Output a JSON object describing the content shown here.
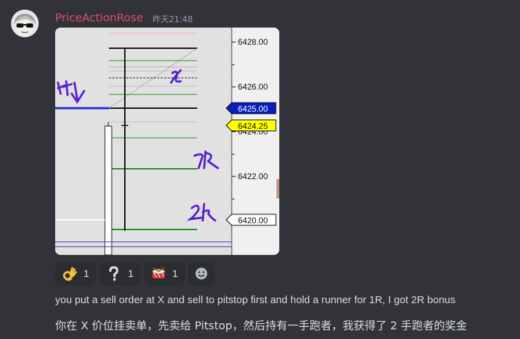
{
  "message": {
    "username": "PriceActionRose",
    "timestamp": "昨天21:48",
    "text_en": "you put a sell order at X and sell to pitstop first and hold a runner for 1R, I got 2R bonus",
    "text_zh": "你在 X 价位挂卖单，先卖给 Pitstop，然后持有一手跑者，我获得了 2 手跑者的奖金"
  },
  "chart": {
    "axis_labels": [
      "6428.00",
      "6426.00",
      "6424.00",
      "6422.00",
      "6420.00"
    ],
    "price_tags": {
      "blue": "6425.00",
      "yellow": "6424.25",
      "white": "6420.00"
    },
    "annotations": {
      "pitstop": "pit↓",
      "x": "x",
      "one_r": "1R",
      "two_r": "2R"
    },
    "colors": {
      "blue_tag": "#0a1fbe",
      "yellow_tag": "#ffff00",
      "green_line": "#1f8f1f",
      "ink": "#5a1fd1"
    }
  },
  "reactions": [
    {
      "emoji": "ok-hand-icon",
      "count": "1"
    },
    {
      "emoji": "question-icon",
      "count": "1"
    },
    {
      "emoji": "drum-icon",
      "count": "1"
    }
  ],
  "add_reaction_label": "add-reaction"
}
